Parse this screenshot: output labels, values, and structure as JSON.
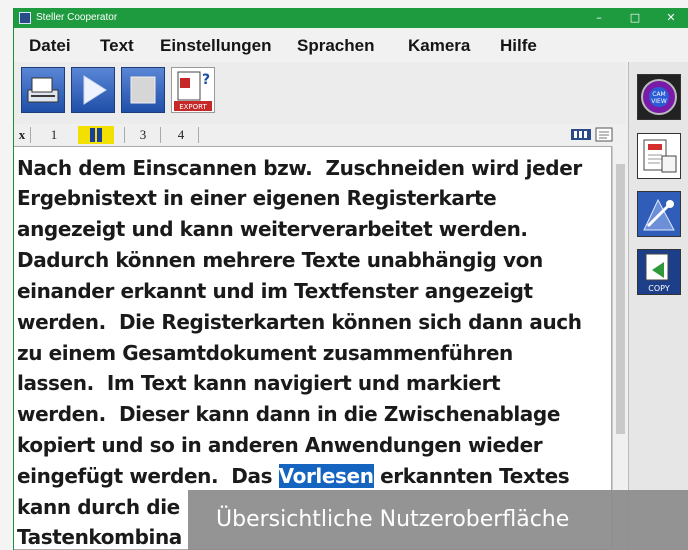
{
  "window": {
    "title": "Steller Cooperator",
    "controls": {
      "minimize": "–",
      "maximize": "□",
      "close": "✕"
    }
  },
  "menu": [
    "Datei",
    "Text",
    "Einstellungen",
    "Sprachen",
    "Kamera",
    "Hilfe"
  ],
  "toolbar": {
    "buttons": [
      "scan-icon",
      "play-icon",
      "stop-icon",
      "export-icon"
    ],
    "export_label": "EXPORT"
  },
  "tabs": {
    "close": "x",
    "items": [
      "1",
      "2",
      "3",
      "4"
    ],
    "active_index": 1
  },
  "text": {
    "lines": [
      "Nach dem Einscannen bzw.  Zuschneiden wird jeder",
      "Ergebnistext in einer eigenen Registerkarte",
      "angezeigt und kann weiterverarbeitet werden.",
      "Dadurch können mehrere Texte unabhängig von",
      "einander erkannt und im Textfenster angezeigt",
      "werden.  Die Registerkarten können sich dann auch",
      "zu einem Gesamtdokument zusammenführen",
      "lassen.  Im Text kann navigiert und markiert",
      "werden.  Dieser kann dann in die Zwischenablage",
      "kopiert und so in anderen Anwendungen wieder"
    ],
    "line_11_before": "eingefügt werden.  Das ",
    "line_11_highlight": "Vorlesen",
    "line_11_after": " erkannten Textes",
    "line_12": "kann durch die",
    "line_13": "Tastenkombina"
  },
  "sidebar": {
    "buttons": [
      "camview-icon",
      "pdf-document-icon",
      "tools-icon",
      "copy-icon"
    ],
    "camview_label": "CAM VIEW",
    "copy_label": "COPY"
  },
  "caption": "Übersichtliche Nutzeroberfläche",
  "colors": {
    "titlebar": "#1e9a3f",
    "highlight": "#1565c0",
    "active_tab": "#f2e000"
  }
}
